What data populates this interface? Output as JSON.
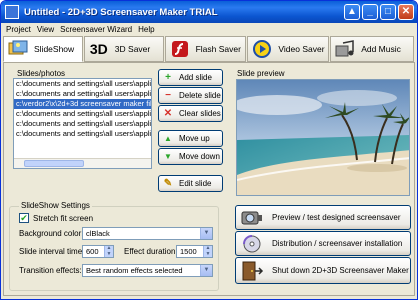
{
  "window": {
    "title": "Untitled - 2D+3D Screensaver Maker TRIAL"
  },
  "menu": [
    "Project",
    "View",
    "Screensaver Wizard",
    "Help"
  ],
  "toolbar": {
    "tabs": [
      {
        "label": "SlideShow",
        "icon": "slideshow-icon"
      },
      {
        "label": "3D Saver",
        "icon": "3d-icon"
      },
      {
        "label": "Flash Saver",
        "icon": "flash-icon"
      },
      {
        "label": "Video Saver",
        "icon": "video-icon"
      },
      {
        "label": "Add Music",
        "icon": "music-icon"
      }
    ]
  },
  "slides": {
    "label": "Slides/photos",
    "items": [
      "c:\\documents and settings\\all users\\applic",
      "c:\\documents and settings\\all users\\applic",
      "c:\\verdor2\\x\\2d+3d screensaver maker fil",
      "c:\\documents and settings\\all users\\applic",
      "c:\\documents and settings\\all users\\applic",
      "c:\\documents and settings\\all users\\applic"
    ],
    "selected_index": 2
  },
  "actions": {
    "add": "Add slide",
    "delete": "Delete slide",
    "clear": "Clear slides",
    "move_up": "Move up",
    "move_down": "Move down",
    "edit": "Edit slide"
  },
  "preview": {
    "label": "Slide preview"
  },
  "settings": {
    "label": "SlideShow Settings",
    "stretch_label": "Stretch fit screen",
    "stretch_checked": true,
    "bg_label": "Background color:",
    "bg_value": "clBlack",
    "interval_label": "Slide interval time:",
    "interval_value": "600",
    "duration_label": "Effect duration:",
    "duration_value": "1500",
    "transition_label": "Transition effects:",
    "transition_value": "Best random effects selected"
  },
  "big_buttons": {
    "preview": "Preview / test designed screensaver",
    "distribution": "Distribution / screensaver installation",
    "shutdown": "Shut down 2D+3D Screensaver Maker"
  },
  "colors": {
    "titlebar": "#0a5fd8",
    "selection": "#316ac5",
    "face": "#ece9d8"
  }
}
